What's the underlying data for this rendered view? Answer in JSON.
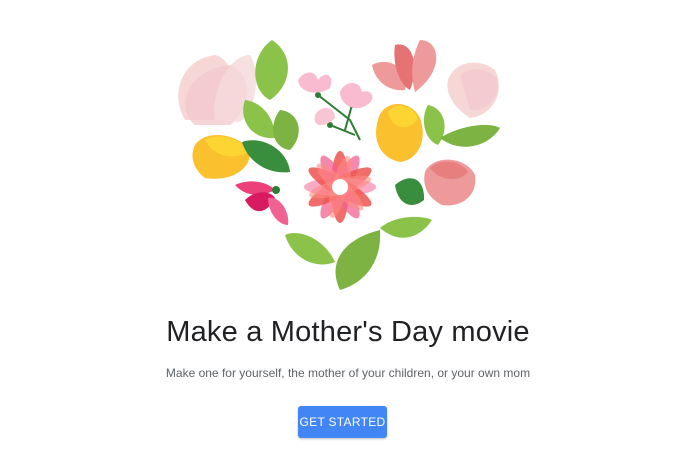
{
  "main": {
    "headline": "Make a Mother's Day movie",
    "subtitle": "Make one for yourself, the mother of your children, or your own mom",
    "cta_label": "GET STARTED"
  },
  "colors": {
    "button": "#4285f4",
    "button_text": "#ffffff",
    "headline": "#202124",
    "subtitle": "#5f6368",
    "leaf_light": "#8bc34a",
    "leaf_dark": "#388e3c",
    "tulip_yellow": "#fbc02d",
    "petal_pink": "#f8bbd0",
    "petal_coral": "#ef5350",
    "petal_magenta": "#d81b60"
  },
  "illustration": {
    "icon": "flower-heart-illustration"
  }
}
